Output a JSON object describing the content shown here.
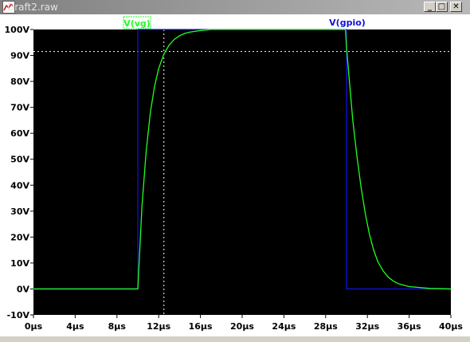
{
  "window": {
    "title": "Draft2.raw",
    "controls": {
      "minimize": "_",
      "maximize": "□",
      "close": "✕"
    }
  },
  "colors": {
    "plot_bg": "#000000",
    "frame_bg": "#ffffff",
    "axis_text": "#000000",
    "cursor": "#ffffff",
    "vg": "#22ff22",
    "gpio": "#1010dd"
  },
  "icons": [
    "waveform-icon"
  ],
  "chart_data": {
    "type": "line",
    "xlabel": "",
    "ylabel": "",
    "xlim": [
      0,
      40
    ],
    "ylim": [
      -10,
      100
    ],
    "x_ticks": [
      0,
      4,
      8,
      12,
      16,
      20,
      24,
      28,
      32,
      36,
      40
    ],
    "x_tick_labels": [
      "0µs",
      "4µs",
      "8µs",
      "12µs",
      "16µs",
      "20µs",
      "24µs",
      "28µs",
      "32µs",
      "36µs",
      "40µs"
    ],
    "y_ticks": [
      -10,
      0,
      10,
      20,
      30,
      40,
      50,
      60,
      70,
      80,
      90,
      100
    ],
    "y_tick_labels": [
      "-10V",
      "0V",
      "10V",
      "20V",
      "30V",
      "40V",
      "50V",
      "60V",
      "70V",
      "80V",
      "90V",
      "100V"
    ],
    "grid": false,
    "cursor": {
      "x": 12.5,
      "y": 91.5
    },
    "series": [
      {
        "name": "V(vg)",
        "color": "#22ff22",
        "x": [
          0,
          10,
          10.4,
          10.8,
          11.2,
          11.6,
          12.0,
          12.5,
          13.0,
          13.5,
          14.0,
          14.5,
          15.0,
          16.0,
          17.0,
          20,
          29.9,
          30.0,
          30.3,
          30.6,
          31.0,
          31.4,
          31.8,
          32.2,
          32.6,
          33.0,
          33.5,
          34.0,
          34.5,
          35.0,
          36.0,
          38.0,
          40.0
        ],
        "y": [
          0,
          0,
          32,
          53,
          68,
          78,
          85,
          90.5,
          94,
          96.2,
          97.6,
          98.5,
          99.0,
          99.6,
          100,
          100,
          100,
          93,
          79,
          65,
          51,
          39,
          29,
          21,
          15,
          10.5,
          7,
          4.5,
          3,
          2,
          0.9,
          0.2,
          0
        ]
      },
      {
        "name": "V(gpio)",
        "color": "#1010dd",
        "x": [
          0,
          10,
          10,
          30,
          30,
          40
        ],
        "y": [
          0,
          0,
          100,
          100,
          0,
          0
        ]
      }
    ]
  }
}
